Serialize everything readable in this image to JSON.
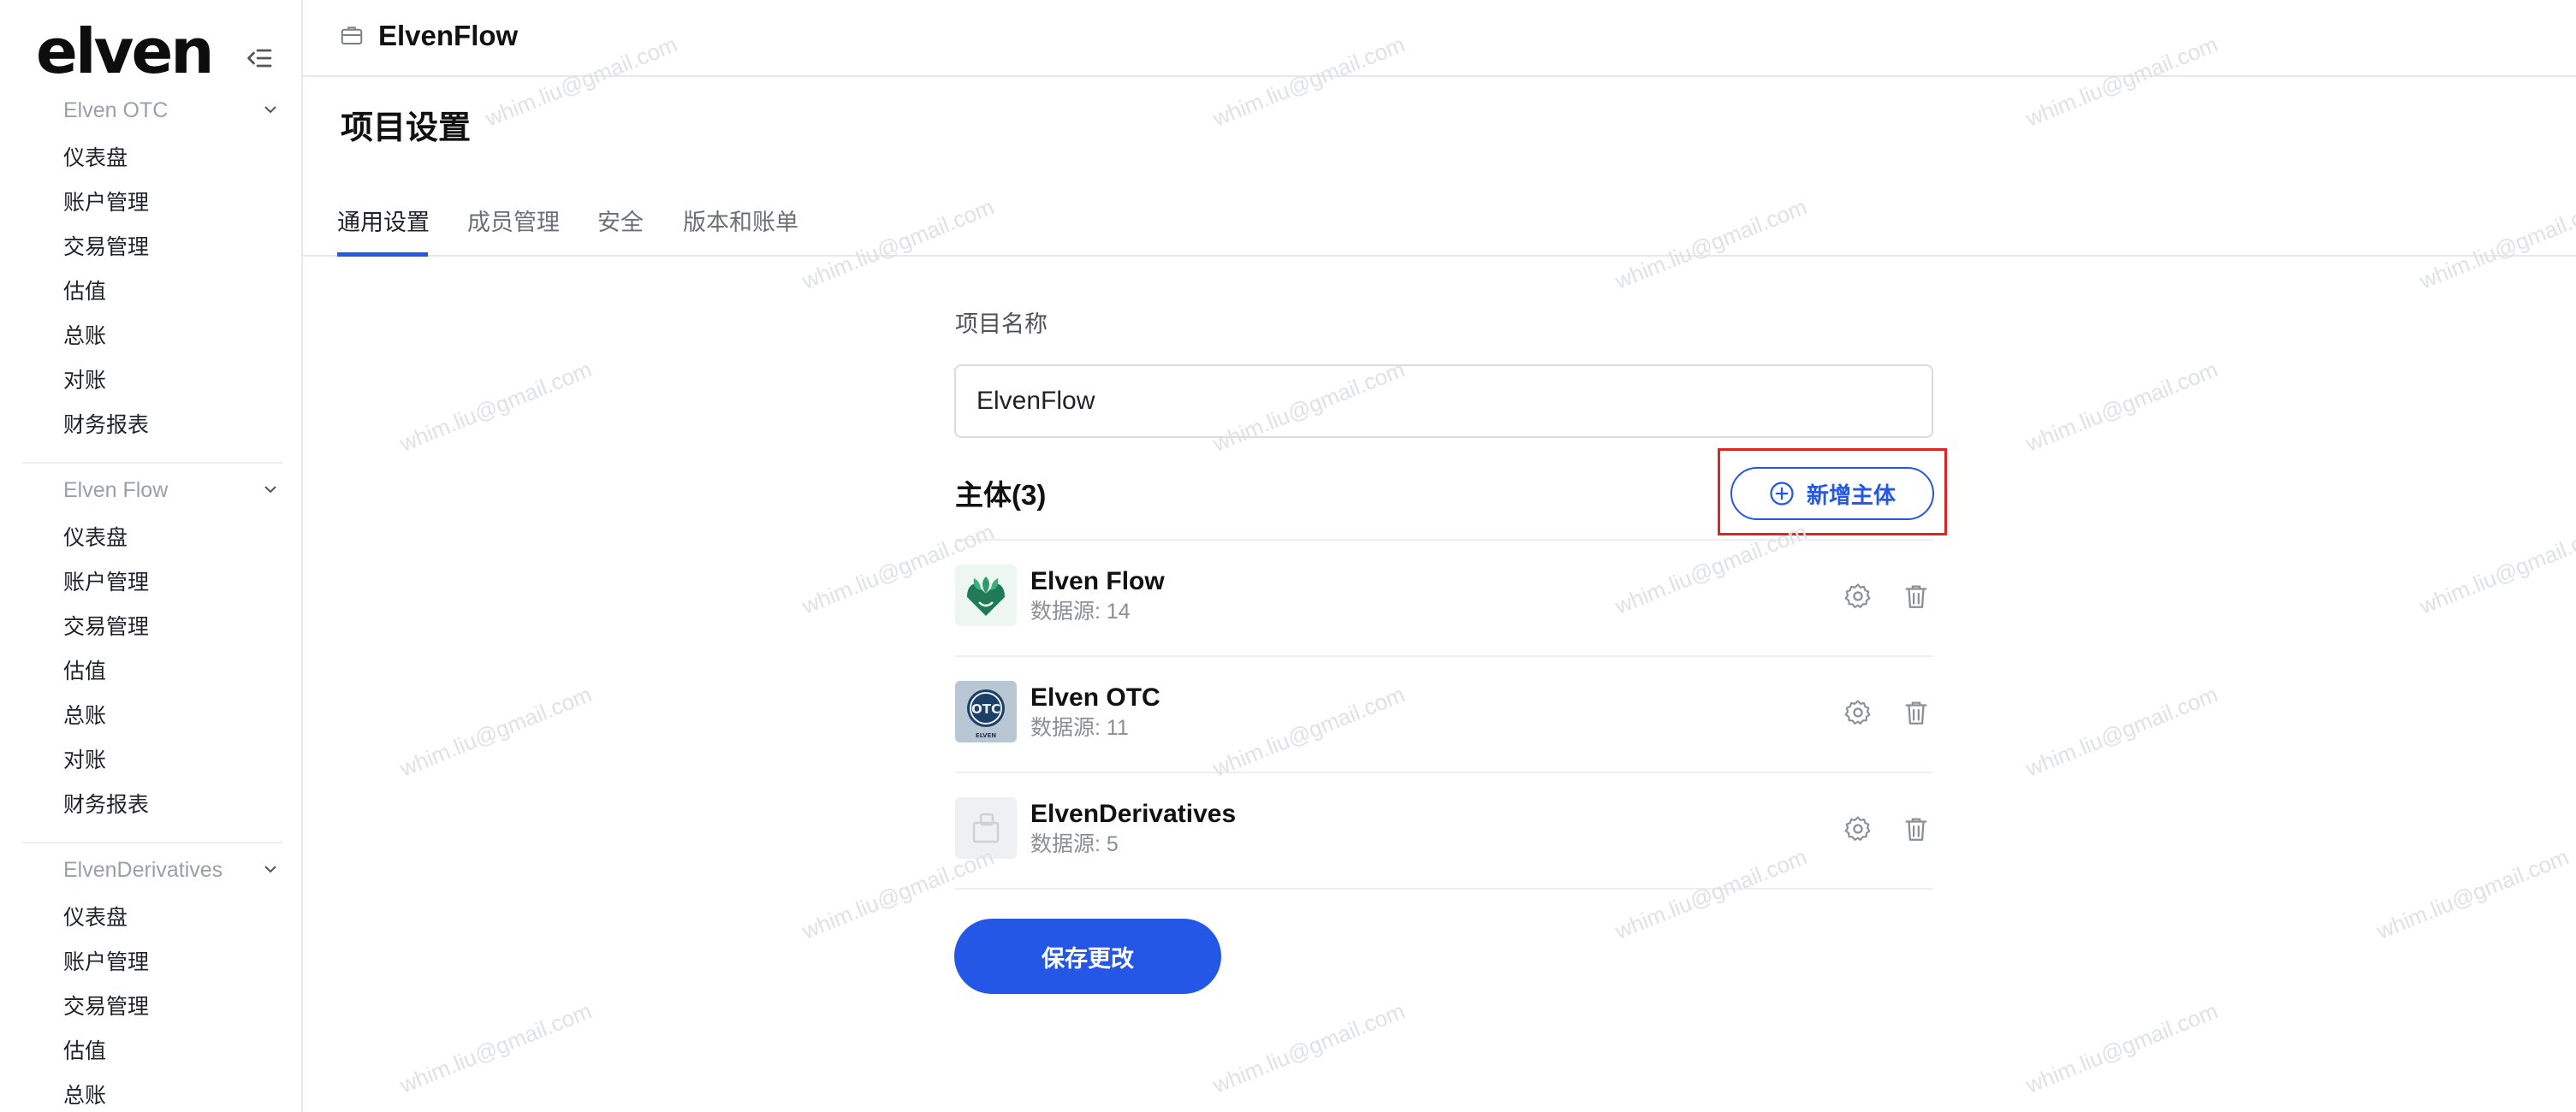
{
  "app": {
    "logo_text": "elven"
  },
  "sidebar": {
    "groups": [
      {
        "title": "Elven OTC",
        "items": [
          "仪表盘",
          "账户管理",
          "交易管理",
          "估值",
          "总账",
          "对账",
          "财务报表"
        ]
      },
      {
        "title": "Elven Flow",
        "items": [
          "仪表盘",
          "账户管理",
          "交易管理",
          "估值",
          "总账",
          "对账",
          "财务报表"
        ]
      },
      {
        "title": "ElvenDerivatives",
        "items": [
          "仪表盘",
          "账户管理",
          "交易管理",
          "估值",
          "总账"
        ]
      }
    ]
  },
  "header": {
    "project_name": "ElvenFlow"
  },
  "page": {
    "title": "项目设置"
  },
  "tabs": [
    {
      "label": "通用设置",
      "active": true
    },
    {
      "label": "成员管理",
      "active": false
    },
    {
      "label": "安全",
      "active": false
    },
    {
      "label": "版本和账单",
      "active": false
    }
  ],
  "form": {
    "project_name_label": "项目名称",
    "project_name_value": "ElvenFlow",
    "entities_title": "主体(3)",
    "add_entity_label": "新增主体",
    "save_label": "保存更改"
  },
  "entities": [
    {
      "name": "Elven Flow",
      "meta": "数据源: 14",
      "logo": "leaf-logo"
    },
    {
      "name": "Elven OTC",
      "meta": "数据源: 11",
      "logo": "otc-logo"
    },
    {
      "name": "ElvenDerivatives",
      "meta": "数据源: 5",
      "logo": "placeholder-logo"
    }
  ],
  "watermark": {
    "text": "whim.liu@gmail.com"
  },
  "colors": {
    "accent": "#2557e6",
    "highlight": "#e02424"
  }
}
